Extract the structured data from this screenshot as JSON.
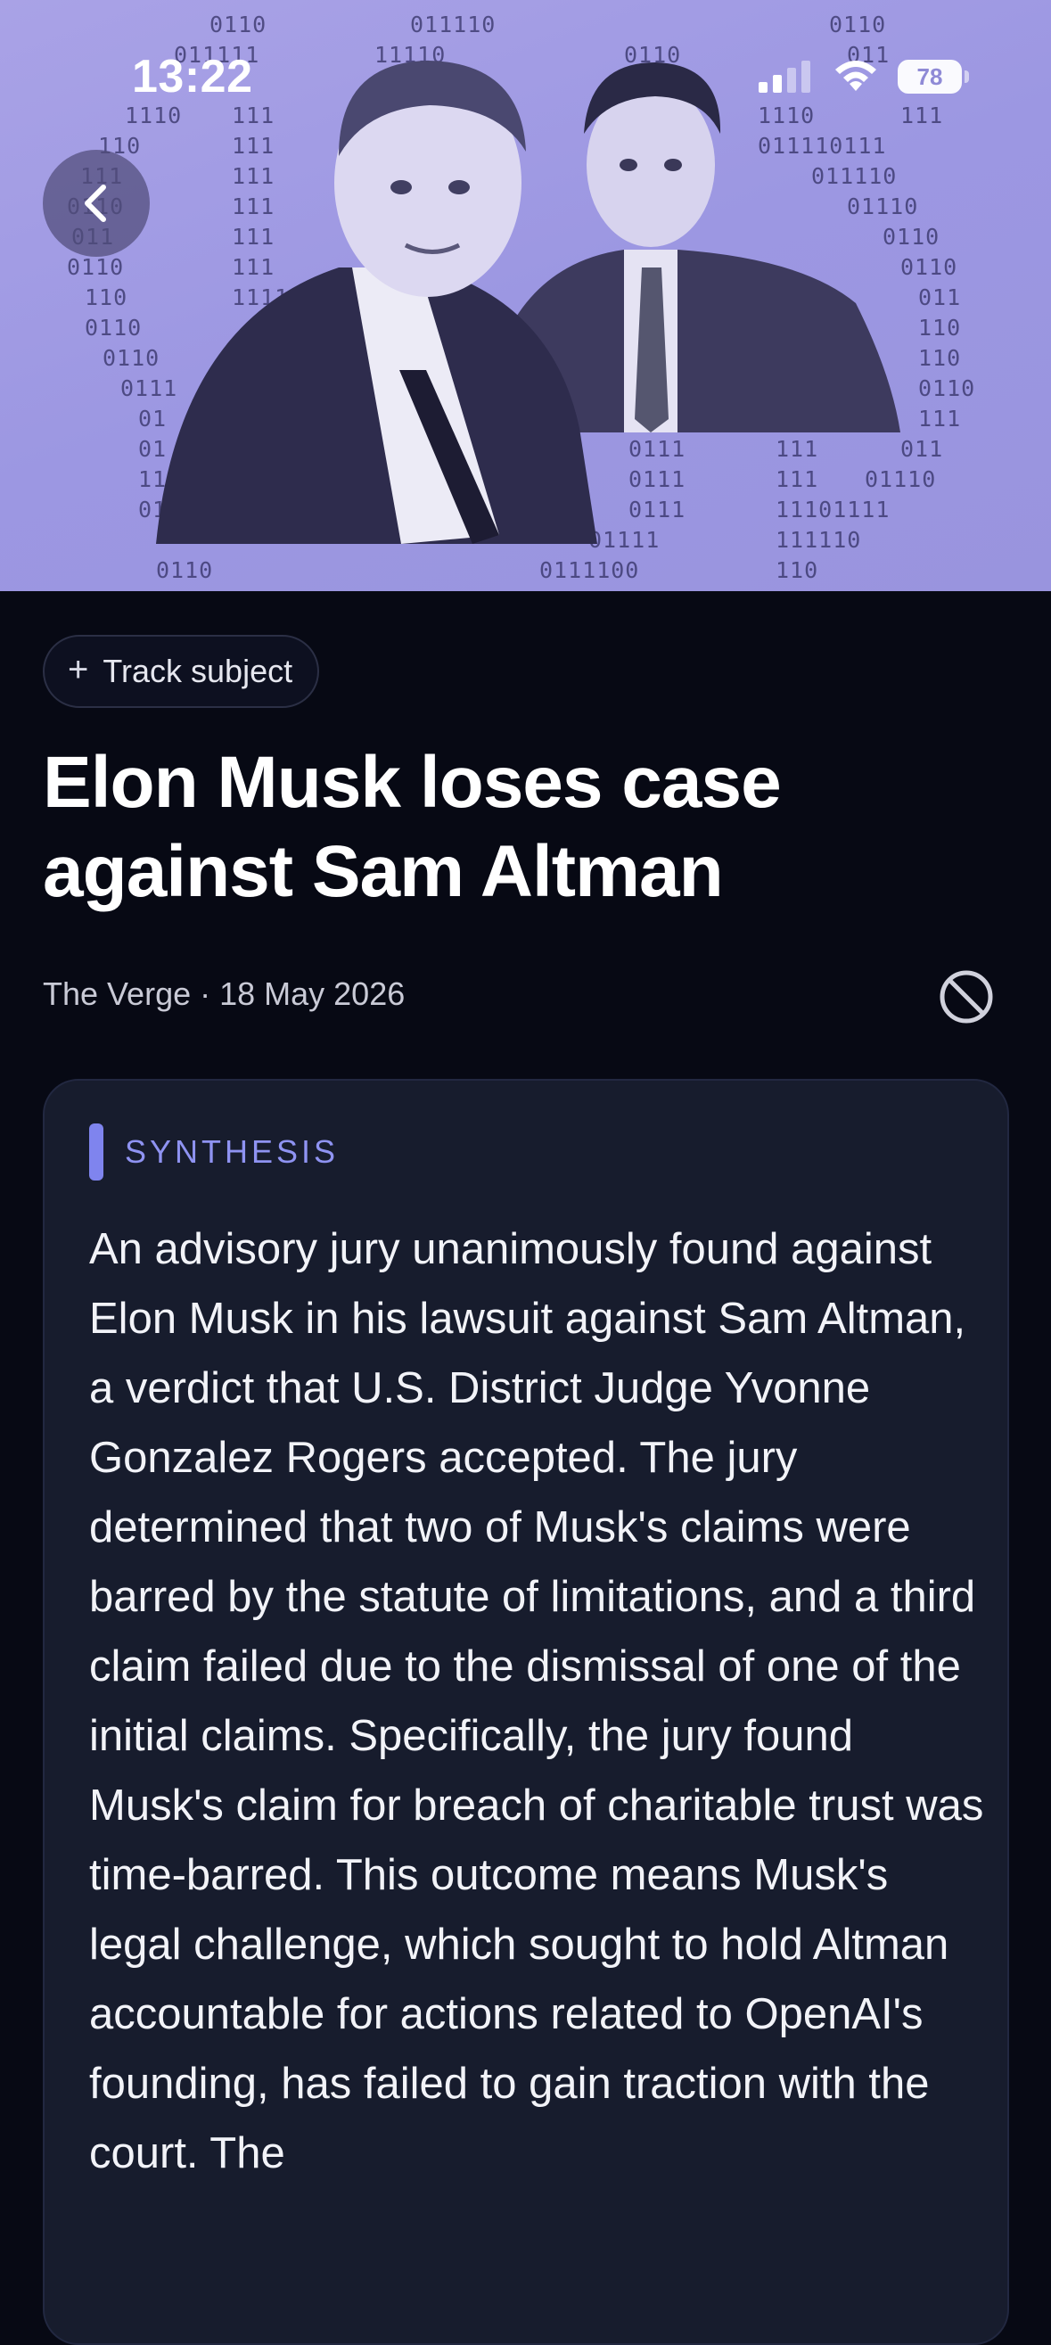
{
  "status_bar": {
    "time": "13:22",
    "battery": "78"
  },
  "hero": {
    "image": "Elon Musk and Sam Altman over binary code background",
    "binary_lines": [
      "0110      011110      0110",
      "011111   11110   0110  011"
    ]
  },
  "nav": {
    "back_icon": "chevron-left-icon"
  },
  "article": {
    "track_label": "Track subject",
    "title": "Elon Musk loses case against Sam Altman",
    "meta": "The Verge · 18 May 2026",
    "synthesis_label": "SYNTHESIS",
    "synthesis_text": "An advisory jury unanimously found against Elon Musk in his lawsuit against Sam Altman, a verdict that U.S. District Judge Yvonne Gonzalez Rogers accepted. The jury determined that two of Musk's claims were barred by the statute of limitations, and a third claim failed due to the dismissal of one of the initial claims. Specifically, the jury found Musk's claim for breach of charitable trust was time-barred. This outcome means Musk's legal challenge, which sought to hold Altman accountable for actions related to OpenAI's founding, has failed to gain traction with the court. The"
  },
  "colors": {
    "background": "#070914",
    "card": "#171c2d",
    "accent": "#7f84ee",
    "hero_tint": "#9c97e2"
  }
}
